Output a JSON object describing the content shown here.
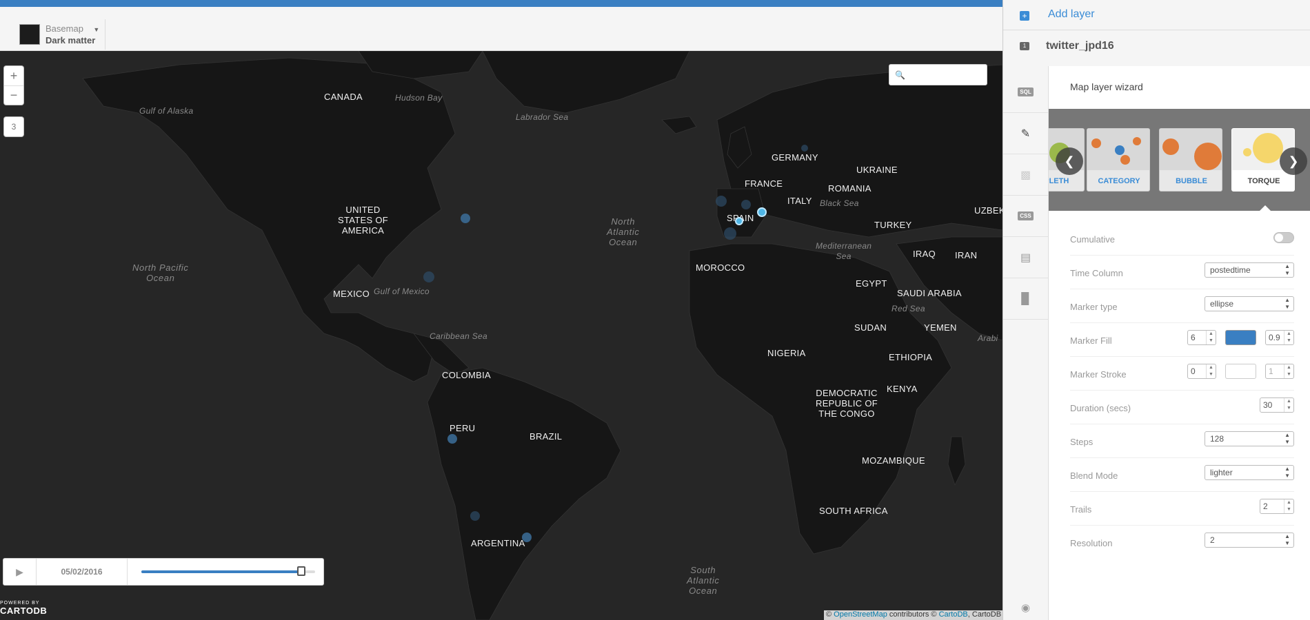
{
  "header": {
    "basemap_label": "Basemap",
    "basemap_value": "Dark matter"
  },
  "map": {
    "zoom_in": "+",
    "zoom_out": "−",
    "zoom_level": "3",
    "search_placeholder": "",
    "labels": {
      "canada": "CANADA",
      "usa": "UNITED\nSTATES OF\nAMERICA",
      "mexico": "MEXICO",
      "colombia": "COLOMBIA",
      "peru": "PERU",
      "brazil": "BRAZIL",
      "argentina": "ARGENTINA",
      "germany": "GERMANY",
      "france": "FRANCE",
      "spain": "SPAIN",
      "italy": "ITALY",
      "ukraine": "UKRAINE",
      "romania": "ROMANIA",
      "turkey": "TURKEY",
      "morocco": "MOROCCO",
      "egypt": "EGYPT",
      "iraq": "IRAQ",
      "iran": "IRAN",
      "uzbek": "UZBEK",
      "saudi": "SAUDI ARABIA",
      "sudan": "SUDAN",
      "yemen": "YEMEN",
      "nigeria": "NIGERIA",
      "ethiopia": "ETHIOPIA",
      "kenya": "KENYA",
      "drc": "DEMOCRATIC\nREPUBLIC OF\nTHE CONGO",
      "mozambique": "MOZAMBIQUE",
      "south_africa": "SOUTH AFRICA",
      "gulf_alaska": "Gulf of Alaska",
      "hudson_bay": "Hudson Bay",
      "labrador_sea": "Labrador Sea",
      "north_pacific": "North Pacific\nOcean",
      "north_atlantic": "North\nAtlantic\nOcean",
      "gulf_mexico": "Gulf of Mexico",
      "caribbean": "Caribbean Sea",
      "black_sea": "Black Sea",
      "mediterranean": "Mediterranean\nSea",
      "red_sea": "Red Sea",
      "arabi": "Arabi",
      "south_atlantic": "South\nAtlantic\nOcean"
    }
  },
  "timeline": {
    "play_icon": "▶",
    "date": "05/02/2016",
    "progress": 0.92
  },
  "footer": {
    "powered_by": "POWERED BY",
    "logo": "CARTODB",
    "attribution_prefix": "© ",
    "attribution_osm": "OpenStreetMap",
    "attribution_mid": " contributors © ",
    "attribution_cartodb_link": "CartoDB",
    "attribution_suffix": ", CartoDB"
  },
  "panel": {
    "add_layer": "Add layer",
    "layer_number": "1",
    "layer_name": "twitter_jpd16",
    "tools": [
      {
        "name": "sql",
        "label": "SQL"
      },
      {
        "name": "wizard",
        "icon": "paintbrush-icon"
      },
      {
        "name": "infowindow",
        "icon": "speech-bubble-icon"
      },
      {
        "name": "css",
        "label": "CSS"
      },
      {
        "name": "legend",
        "icon": "legend-icon"
      },
      {
        "name": "filters",
        "icon": "bar-chart-icon"
      }
    ],
    "wizard_title": "Map layer wizard",
    "cards": [
      "OPLETH",
      "CATEGORY",
      "BUBBLE",
      "TORQUE"
    ],
    "selected_card": "TORQUE",
    "properties": {
      "cumulative": {
        "label": "Cumulative",
        "value": false
      },
      "time_column": {
        "label": "Time Column",
        "value": "postedtime"
      },
      "marker_type": {
        "label": "Marker type",
        "value": "ellipse"
      },
      "marker_fill": {
        "label": "Marker Fill",
        "width": "6",
        "opacity": "0.9",
        "color": "#3a7fc2"
      },
      "marker_stroke": {
        "label": "Marker Stroke",
        "width": "0",
        "opacity": "1"
      },
      "duration": {
        "label": "Duration (secs)",
        "value": "30"
      },
      "steps": {
        "label": "Steps",
        "value": "128"
      },
      "blend_mode": {
        "label": "Blend Mode",
        "value": "lighter"
      },
      "trails": {
        "label": "Trails",
        "value": "2"
      },
      "resolution": {
        "label": "Resolution",
        "value": "2"
      }
    }
  },
  "colors": {
    "accent": "#3a8cd6",
    "map_bg": "#262626",
    "land": "#161616"
  }
}
